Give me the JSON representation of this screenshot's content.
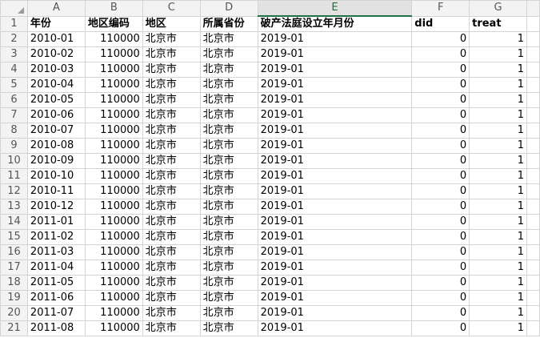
{
  "columns": [
    "A",
    "B",
    "C",
    "D",
    "E",
    "F",
    "G"
  ],
  "selected_column": "E",
  "header": [
    "年份",
    "地区编码",
    "地区",
    "所属省份",
    "破产法庭设立年月份",
    "did",
    "treat"
  ],
  "rows": [
    [
      "2010-01",
      "110000",
      "北京市",
      "北京市",
      "2019-01",
      "0",
      "1"
    ],
    [
      "2010-02",
      "110000",
      "北京市",
      "北京市",
      "2019-01",
      "0",
      "1"
    ],
    [
      "2010-03",
      "110000",
      "北京市",
      "北京市",
      "2019-01",
      "0",
      "1"
    ],
    [
      "2010-04",
      "110000",
      "北京市",
      "北京市",
      "2019-01",
      "0",
      "1"
    ],
    [
      "2010-05",
      "110000",
      "北京市",
      "北京市",
      "2019-01",
      "0",
      "1"
    ],
    [
      "2010-06",
      "110000",
      "北京市",
      "北京市",
      "2019-01",
      "0",
      "1"
    ],
    [
      "2010-07",
      "110000",
      "北京市",
      "北京市",
      "2019-01",
      "0",
      "1"
    ],
    [
      "2010-08",
      "110000",
      "北京市",
      "北京市",
      "2019-01",
      "0",
      "1"
    ],
    [
      "2010-09",
      "110000",
      "北京市",
      "北京市",
      "2019-01",
      "0",
      "1"
    ],
    [
      "2010-10",
      "110000",
      "北京市",
      "北京市",
      "2019-01",
      "0",
      "1"
    ],
    [
      "2010-11",
      "110000",
      "北京市",
      "北京市",
      "2019-01",
      "0",
      "1"
    ],
    [
      "2010-12",
      "110000",
      "北京市",
      "北京市",
      "2019-01",
      "0",
      "1"
    ],
    [
      "2011-01",
      "110000",
      "北京市",
      "北京市",
      "2019-01",
      "0",
      "1"
    ],
    [
      "2011-02",
      "110000",
      "北京市",
      "北京市",
      "2019-01",
      "0",
      "1"
    ],
    [
      "2011-03",
      "110000",
      "北京市",
      "北京市",
      "2019-01",
      "0",
      "1"
    ],
    [
      "2011-04",
      "110000",
      "北京市",
      "北京市",
      "2019-01",
      "0",
      "1"
    ],
    [
      "2011-05",
      "110000",
      "北京市",
      "北京市",
      "2019-01",
      "0",
      "1"
    ],
    [
      "2011-06",
      "110000",
      "北京市",
      "北京市",
      "2019-01",
      "0",
      "1"
    ],
    [
      "2011-07",
      "110000",
      "北京市",
      "北京市",
      "2019-01",
      "0",
      "1"
    ],
    [
      "2011-08",
      "110000",
      "北京市",
      "北京市",
      "2019-01",
      "0",
      "1"
    ]
  ],
  "accent_color": "#217346"
}
